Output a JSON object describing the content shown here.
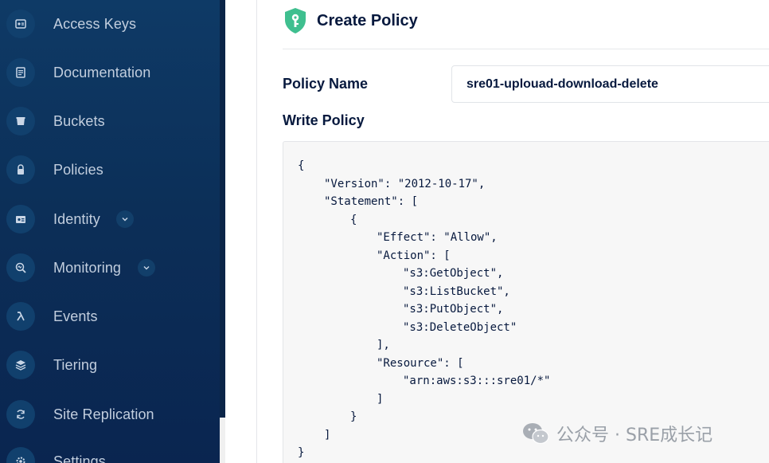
{
  "sidebar": {
    "items": [
      {
        "label": "Access Keys",
        "icon": "access-keys-icon",
        "chevron": false
      },
      {
        "label": "Documentation",
        "icon": "documentation-icon",
        "chevron": false
      },
      {
        "label": "Buckets",
        "icon": "bucket-icon",
        "chevron": false
      },
      {
        "label": "Policies",
        "icon": "lock-icon",
        "chevron": false
      },
      {
        "label": "Identity",
        "icon": "id-card-icon",
        "chevron": true
      },
      {
        "label": "Monitoring",
        "icon": "monitoring-icon",
        "chevron": true
      },
      {
        "label": "Events",
        "icon": "lambda-icon",
        "chevron": false
      },
      {
        "label": "Tiering",
        "icon": "layers-icon",
        "chevron": false
      },
      {
        "label": "Site Replication",
        "icon": "replication-icon",
        "chevron": false
      },
      {
        "label": "Settings",
        "icon": "gear-icon",
        "chevron": false
      }
    ]
  },
  "header": {
    "title": "Create Policy"
  },
  "form": {
    "policy_name_label": "Policy Name",
    "policy_name_value": "sre01-uplouad-download-delete",
    "write_policy_label": "Write Policy"
  },
  "editor": {
    "lines": [
      {
        "indent": 0,
        "text": "{"
      },
      {
        "indent": 1,
        "text": "\"Version\": \"2012-10-17\","
      },
      {
        "indent": 1,
        "text": "\"Statement\": ["
      },
      {
        "indent": 2,
        "text": "{"
      },
      {
        "indent": 3,
        "text": "\"Effect\": \"Allow\","
      },
      {
        "indent": 3,
        "text": "\"Action\": ["
      },
      {
        "indent": 4,
        "text": "\"s3:GetObject\","
      },
      {
        "indent": 4,
        "text": "\"s3:ListBucket\","
      },
      {
        "indent": 4,
        "text": "\"s3:PutObject\","
      },
      {
        "indent": 4,
        "text": "\"s3:DeleteObject\""
      },
      {
        "indent": 3,
        "text": "],"
      },
      {
        "indent": 3,
        "text": "\"Resource\": ["
      },
      {
        "indent": 4,
        "text": "\"arn:aws:s3:::sre01/*\""
      },
      {
        "indent": 3,
        "text": "]"
      },
      {
        "indent": 2,
        "text": "}"
      },
      {
        "indent": 1,
        "text": "]"
      },
      {
        "indent": 0,
        "text": "}"
      }
    ]
  },
  "watermark": {
    "text": "公众号 · SRE成长记"
  },
  "colors": {
    "sidebar_bg": "#0c2f58",
    "title_text": "#07193e",
    "accent_green": "#3fbf8f"
  }
}
